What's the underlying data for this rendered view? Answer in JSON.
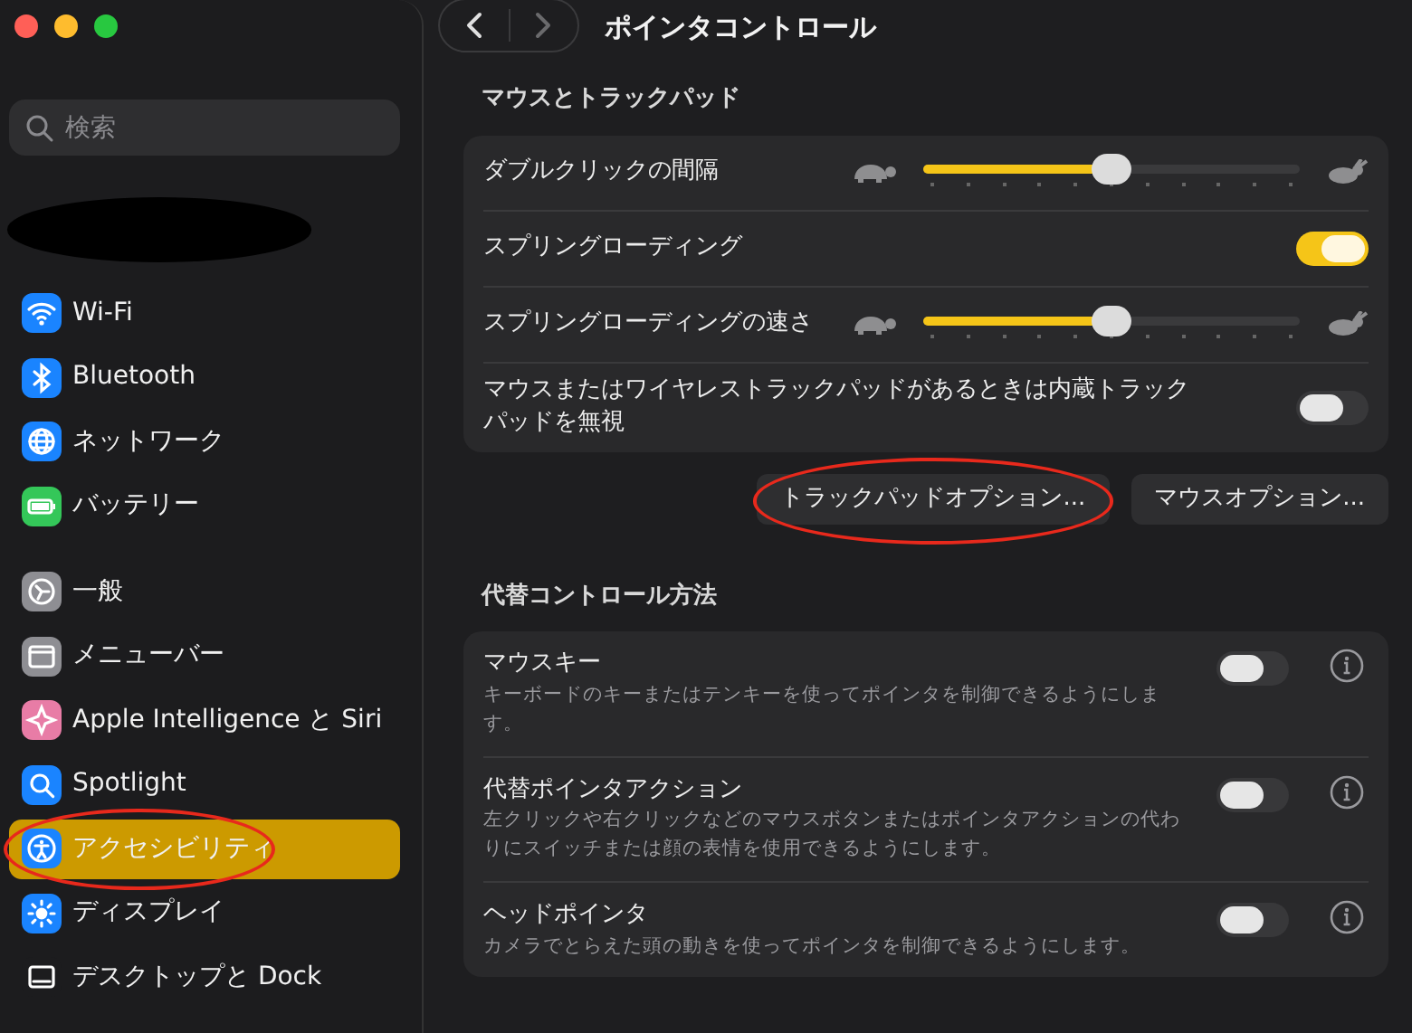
{
  "sidebar": {
    "search": {
      "placeholder": "検索"
    },
    "account": {
      "redacted": true
    },
    "groups": [
      {
        "items": [
          {
            "label": "Wi-Fi",
            "kind": "wifi",
            "color": "#1a84ff",
            "selected": false,
            "highlighted": false
          },
          {
            "label": "Bluetooth",
            "kind": "bluetooth",
            "color": "#1a84ff",
            "selected": false,
            "highlighted": false
          },
          {
            "label": "ネットワーク",
            "kind": "globe",
            "color": "#1a84ff",
            "selected": false,
            "highlighted": false
          },
          {
            "label": "バッテリー",
            "kind": "battery",
            "color": "#34c759",
            "selected": false,
            "highlighted": false
          }
        ]
      },
      {
        "items": [
          {
            "label": "一般",
            "kind": "gear",
            "color": "#8e8e93",
            "selected": false,
            "highlighted": false
          },
          {
            "label": "メニューバー",
            "kind": "menubar",
            "color": "#8e8e93",
            "selected": false,
            "highlighted": false
          },
          {
            "label": "Apple Intelligence と Siri",
            "kind": "sparkle",
            "color": "#e87ca6",
            "selected": false,
            "highlighted": false
          },
          {
            "label": "Spotlight",
            "kind": "magnifier",
            "color": "#1a84ff",
            "selected": false,
            "highlighted": false
          },
          {
            "label": "アクセシビリティ",
            "kind": "person",
            "color": "#1a84ff",
            "selected": true,
            "highlighted": true
          },
          {
            "label": "ディスプレイ",
            "kind": "sun",
            "color": "#1a84ff",
            "selected": false,
            "highlighted": false
          },
          {
            "label": "デスクトップと Dock",
            "kind": "dock",
            "color": "#1c1c1e",
            "selected": false,
            "highlighted": false
          }
        ]
      }
    ]
  },
  "header": {
    "title": "ポインタコントロール",
    "back_disabled": false,
    "forward_disabled": true
  },
  "sections": [
    {
      "title": "マウスとトラックパッド",
      "rows": [
        {
          "kind": "slider",
          "label": "ダブルクリックの間隔",
          "level": 0.5
        },
        {
          "kind": "toggle",
          "label": "スプリングローディング",
          "on": true
        },
        {
          "kind": "slider",
          "label": "スプリングローディングの速さ",
          "level": 0.5
        },
        {
          "kind": "toggle",
          "label": "マウスまたはワイヤレストラックパッドがあるときは内蔵トラックパッドを無視",
          "on": false
        }
      ],
      "buttons": [
        {
          "label": "トラックパッドオプション...",
          "highlighted": true
        },
        {
          "label": "マウスオプション...",
          "highlighted": false
        }
      ]
    },
    {
      "title": "代替コントロール方法",
      "rows": [
        {
          "kind": "toggle_info",
          "label": "マウスキー",
          "description": "キーボードのキーまたはテンキーを使ってポインタを制御できるようにします。",
          "on": false
        },
        {
          "kind": "toggle_info",
          "label": "代替ポインタアクション",
          "description": "左クリックや右クリックなどのマウスボタンまたはポインタアクションの代わりにスイッチまたは顔の表情を使用できるようにします。",
          "on": false
        },
        {
          "kind": "toggle_info",
          "label": "ヘッドポインタ",
          "description": "カメラでとらえた頭の動きを使ってポインタを制御できるようにします。",
          "on": false
        }
      ]
    }
  ]
}
